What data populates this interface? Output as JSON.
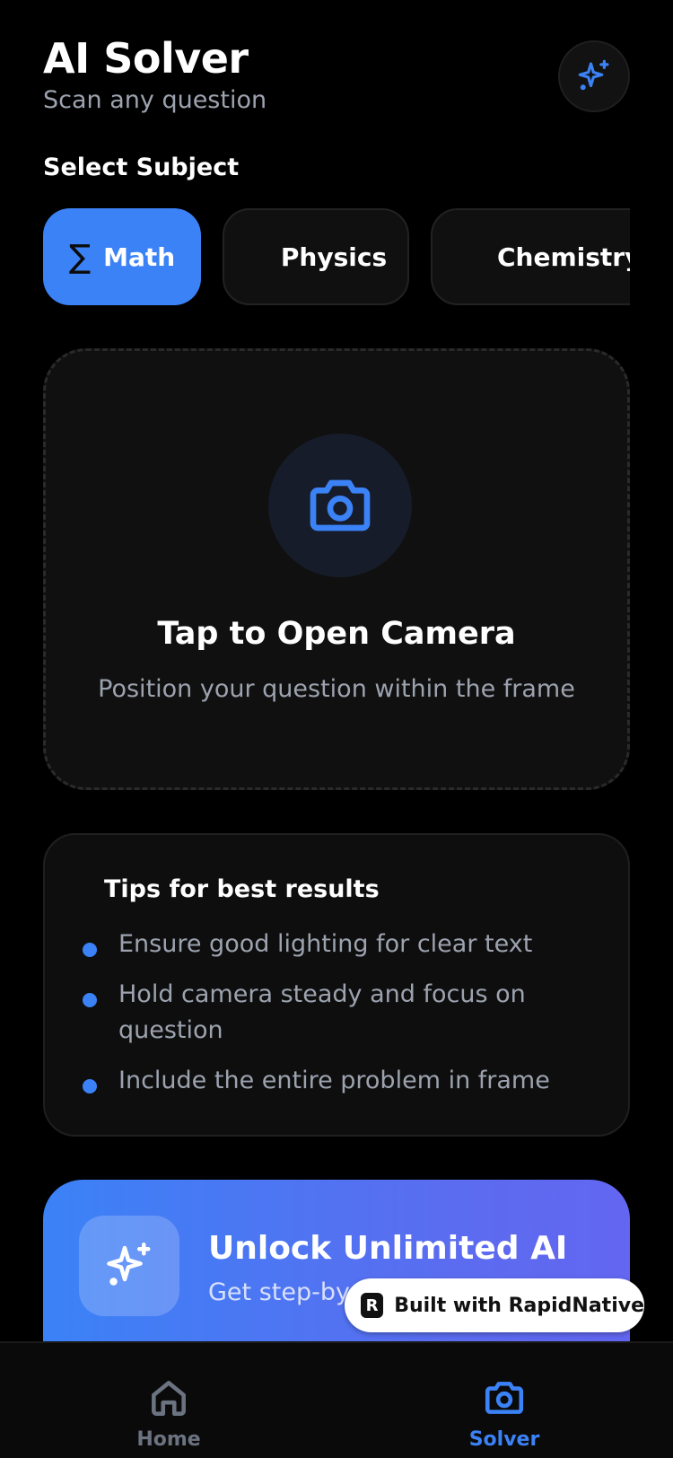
{
  "header": {
    "title": "AI Solver",
    "subtitle": "Scan any question",
    "action_icon": "sparkles-icon"
  },
  "subjects": {
    "label": "Select Subject",
    "items": [
      {
        "symbol": "∑",
        "label": "Math",
        "active": true
      },
      {
        "label": "Physics",
        "active": false
      },
      {
        "label": "Chemistry",
        "active": false
      }
    ]
  },
  "camera": {
    "icon": "camera-icon",
    "title": "Tap to Open Camera",
    "subtitle": "Position your question within the frame"
  },
  "tips": {
    "title": "Tips for best results",
    "items": [
      "Ensure good lighting for clear text",
      "Hold camera steady and focus on question",
      "Include the entire problem in frame"
    ]
  },
  "promo": {
    "icon": "sparkles-icon",
    "title": "Unlock Unlimited AI",
    "subtitle": "Get step-by-"
  },
  "badge": {
    "text": "Built with RapidNative"
  },
  "tabbar": {
    "tabs": [
      {
        "label": "Home",
        "icon": "home-icon",
        "active": false
      },
      {
        "label": "Solver",
        "icon": "camera-icon",
        "active": true
      }
    ]
  },
  "colors": {
    "accent": "#3b82f6",
    "background": "#000000",
    "muted_text": "#9ca3af",
    "inactive_tab": "#6b7280"
  }
}
